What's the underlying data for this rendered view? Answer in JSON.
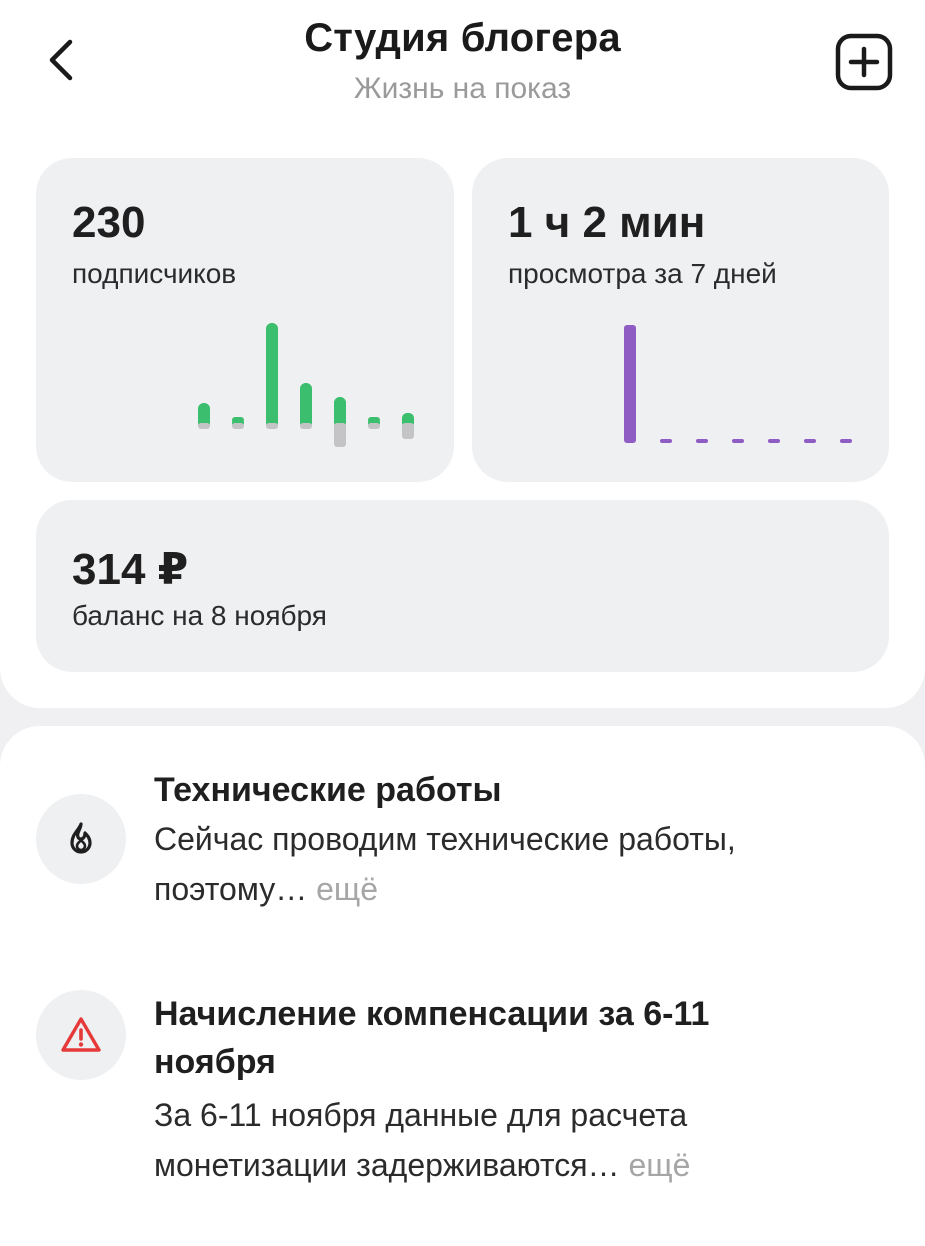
{
  "header": {
    "title": "Студия блогера",
    "subtitle": "Жизнь на показ"
  },
  "stats": {
    "subscribers": {
      "value": "230",
      "label": "подписчиков",
      "chart": {
        "type": "bar",
        "gains": [
          1.0,
          0.3,
          5.0,
          2.0,
          1.3,
          0.3,
          0.5
        ],
        "losses": [
          0.3,
          0.3,
          0.3,
          0.3,
          1.2,
          0.3,
          0.8
        ],
        "color_gain": "#3bbf6e",
        "color_loss": "#c4c4c6"
      }
    },
    "views": {
      "value": "1 ч 2 мин",
      "label": "просмотра за 7 дней",
      "chart": {
        "type": "bar",
        "values": [
          62,
          0,
          0,
          0,
          0,
          0,
          0
        ],
        "color": "#8e5cc2"
      }
    },
    "balance": {
      "value": "314 ₽",
      "label": "баланс на 8 ноября"
    }
  },
  "notices": [
    {
      "icon": "flame-icon",
      "title": "Технические работы",
      "text_lines": [
        "Сейчас проводим технические работы,",
        "поэтому…"
      ],
      "more": "ещё",
      "icon_color": "#1f1f1f"
    },
    {
      "icon": "warning-icon",
      "title_lines": [
        "Начисление компенсации за 6-11",
        "ноября"
      ],
      "text_lines": [
        "За 6-11 ноября данные для расчета",
        "монетизации задерживаются…"
      ],
      "more": "ещё",
      "icon_color": "#e5393a"
    }
  ]
}
